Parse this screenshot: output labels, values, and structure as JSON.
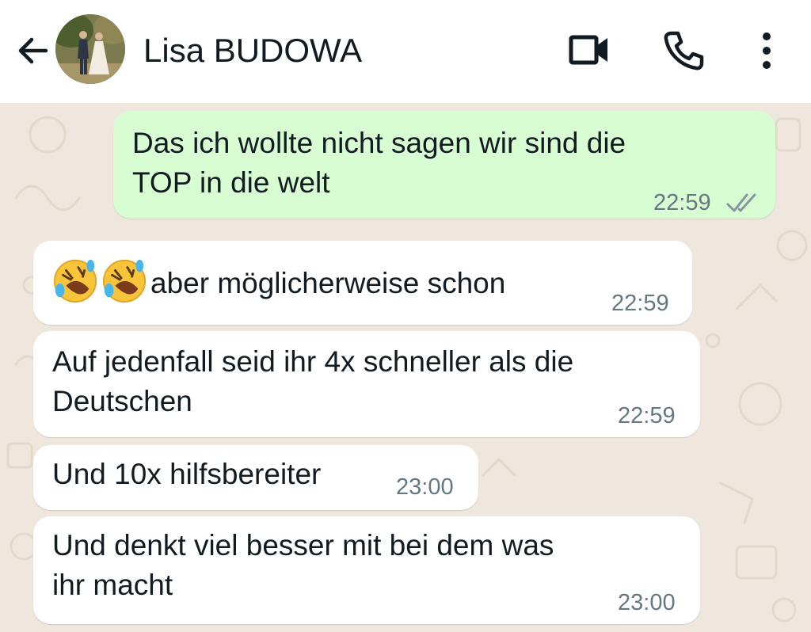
{
  "header": {
    "contact_name": "Lisa BUDOWA",
    "back_icon": "arrow-left-icon",
    "video_icon": "video-camera-icon",
    "call_icon": "phone-icon",
    "menu_icon": "more-vertical-icon"
  },
  "colors": {
    "outgoing_bubble": "#d9fdd3",
    "incoming_bubble": "#ffffff",
    "chat_background": "#efe7dd",
    "read_ticks": "#8696a0"
  },
  "messages": [
    {
      "direction": "outgoing",
      "lines": [
        "Das ich wollte nicht sagen wir sind die",
        "TOP in die welt"
      ],
      "time": "22:59",
      "status": "read"
    },
    {
      "direction": "incoming",
      "emoji": [
        "rolling-on-floor-laughing",
        "rolling-on-floor-laughing"
      ],
      "lines": [
        "aber möglicherweise schon"
      ],
      "time": "22:59"
    },
    {
      "direction": "incoming",
      "lines": [
        "Auf jedenfall seid ihr 4x schneller als die",
        "Deutschen"
      ],
      "time": "22:59"
    },
    {
      "direction": "incoming",
      "lines": [
        "Und 10x hilfsbereiter"
      ],
      "time": "23:00"
    },
    {
      "direction": "incoming",
      "lines": [
        "Und denkt viel besser mit bei dem was",
        "ihr macht"
      ],
      "time": "23:00"
    }
  ]
}
